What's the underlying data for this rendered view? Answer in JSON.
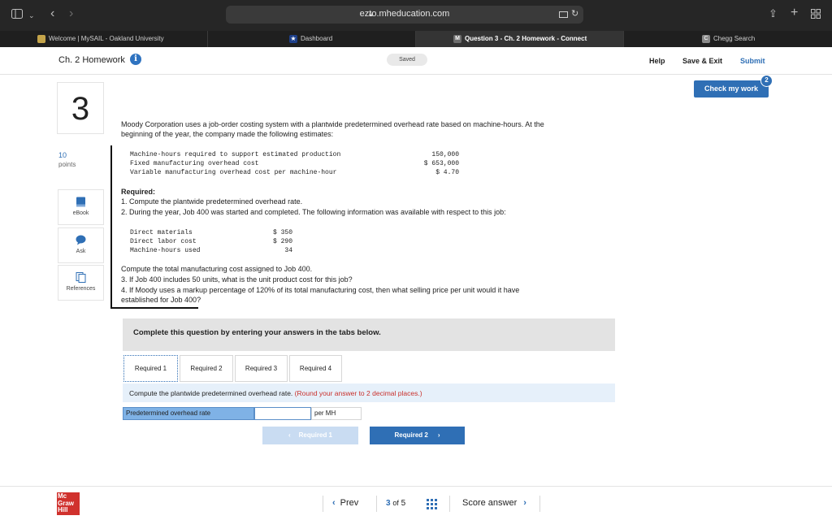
{
  "browser": {
    "url": "ezto.mheducation.com",
    "tabs": [
      {
        "label": "Welcome | MySAIL - Oakland University"
      },
      {
        "label": "Dashboard"
      },
      {
        "label": "Question 3 - Ch. 2 Homework - Connect"
      },
      {
        "label": "Chegg Search"
      }
    ]
  },
  "header": {
    "title": "Ch. 2 Homework",
    "saved": "Saved",
    "help": "Help",
    "save_exit": "Save & Exit",
    "submit": "Submit",
    "check_my_work": "Check my work",
    "check_badge": "2"
  },
  "sidebar": {
    "question_number": "3",
    "points_value": "10",
    "points_label": "points",
    "tools": [
      {
        "label": "eBook",
        "icon": "book-icon"
      },
      {
        "label": "Ask",
        "icon": "chat-bubble-icon"
      },
      {
        "label": "References",
        "icon": "documents-icon"
      }
    ]
  },
  "question": {
    "intro_1": "Moody Corporation uses a job-order costing system with a plantwide predetermined overhead rate based on machine-hours. At the",
    "intro_2": "beginning of the year, the company made the following estimates:",
    "estimates": [
      {
        "label": "Machine-hours required to support estimated production",
        "value": "150,000"
      },
      {
        "label": "Fixed manufacturing overhead cost",
        "value": "$ 653,000"
      },
      {
        "label": "Variable manufacturing overhead cost per machine-hour",
        "value": "$ 4.70"
      }
    ],
    "required_heading": "Required:",
    "req_1": "1. Compute the plantwide predetermined overhead rate.",
    "req_2": "2. During the year, Job 400 was started and completed. The following information was available with respect to this job:",
    "job_data": [
      {
        "label": "Direct materials",
        "value": "$ 350"
      },
      {
        "label": "Direct labor cost",
        "value": "$ 290"
      },
      {
        "label": "Machine-hours used",
        "value": "34"
      }
    ],
    "req_2b": "Compute the total manufacturing cost assigned to Job 400.",
    "req_3": "3. If Job 400 includes 50 units, what is the unit product cost for this job?",
    "req_4a": "4. If Moody uses a markup percentage of 120% of its total manufacturing cost, then what selling price per unit would it have",
    "req_4b": "established for Job 400?"
  },
  "answer": {
    "complete_prompt": "Complete this question by entering your answers in the tabs below.",
    "tabs": [
      "Required 1",
      "Required 2",
      "Required 3",
      "Required 4"
    ],
    "instruction": "Compute the plantwide predetermined overhead rate.",
    "instruction_note": "(Round your answer to 2 decimal places.)",
    "field_label": "Predetermined overhead rate",
    "field_value": "",
    "field_unit": "per MH",
    "prev_button": "Required 1",
    "next_button": "Required 2"
  },
  "footer": {
    "logo_text": "Mc Graw Hill",
    "prev": "Prev",
    "current": "3",
    "of": "of",
    "total": "5",
    "score": "Score answer"
  },
  "colors": {
    "accent": "#2f6fb5",
    "logo_red": "#d0312d",
    "note_red": "#c9302c",
    "input_label_bg": "#7fb2e6"
  }
}
